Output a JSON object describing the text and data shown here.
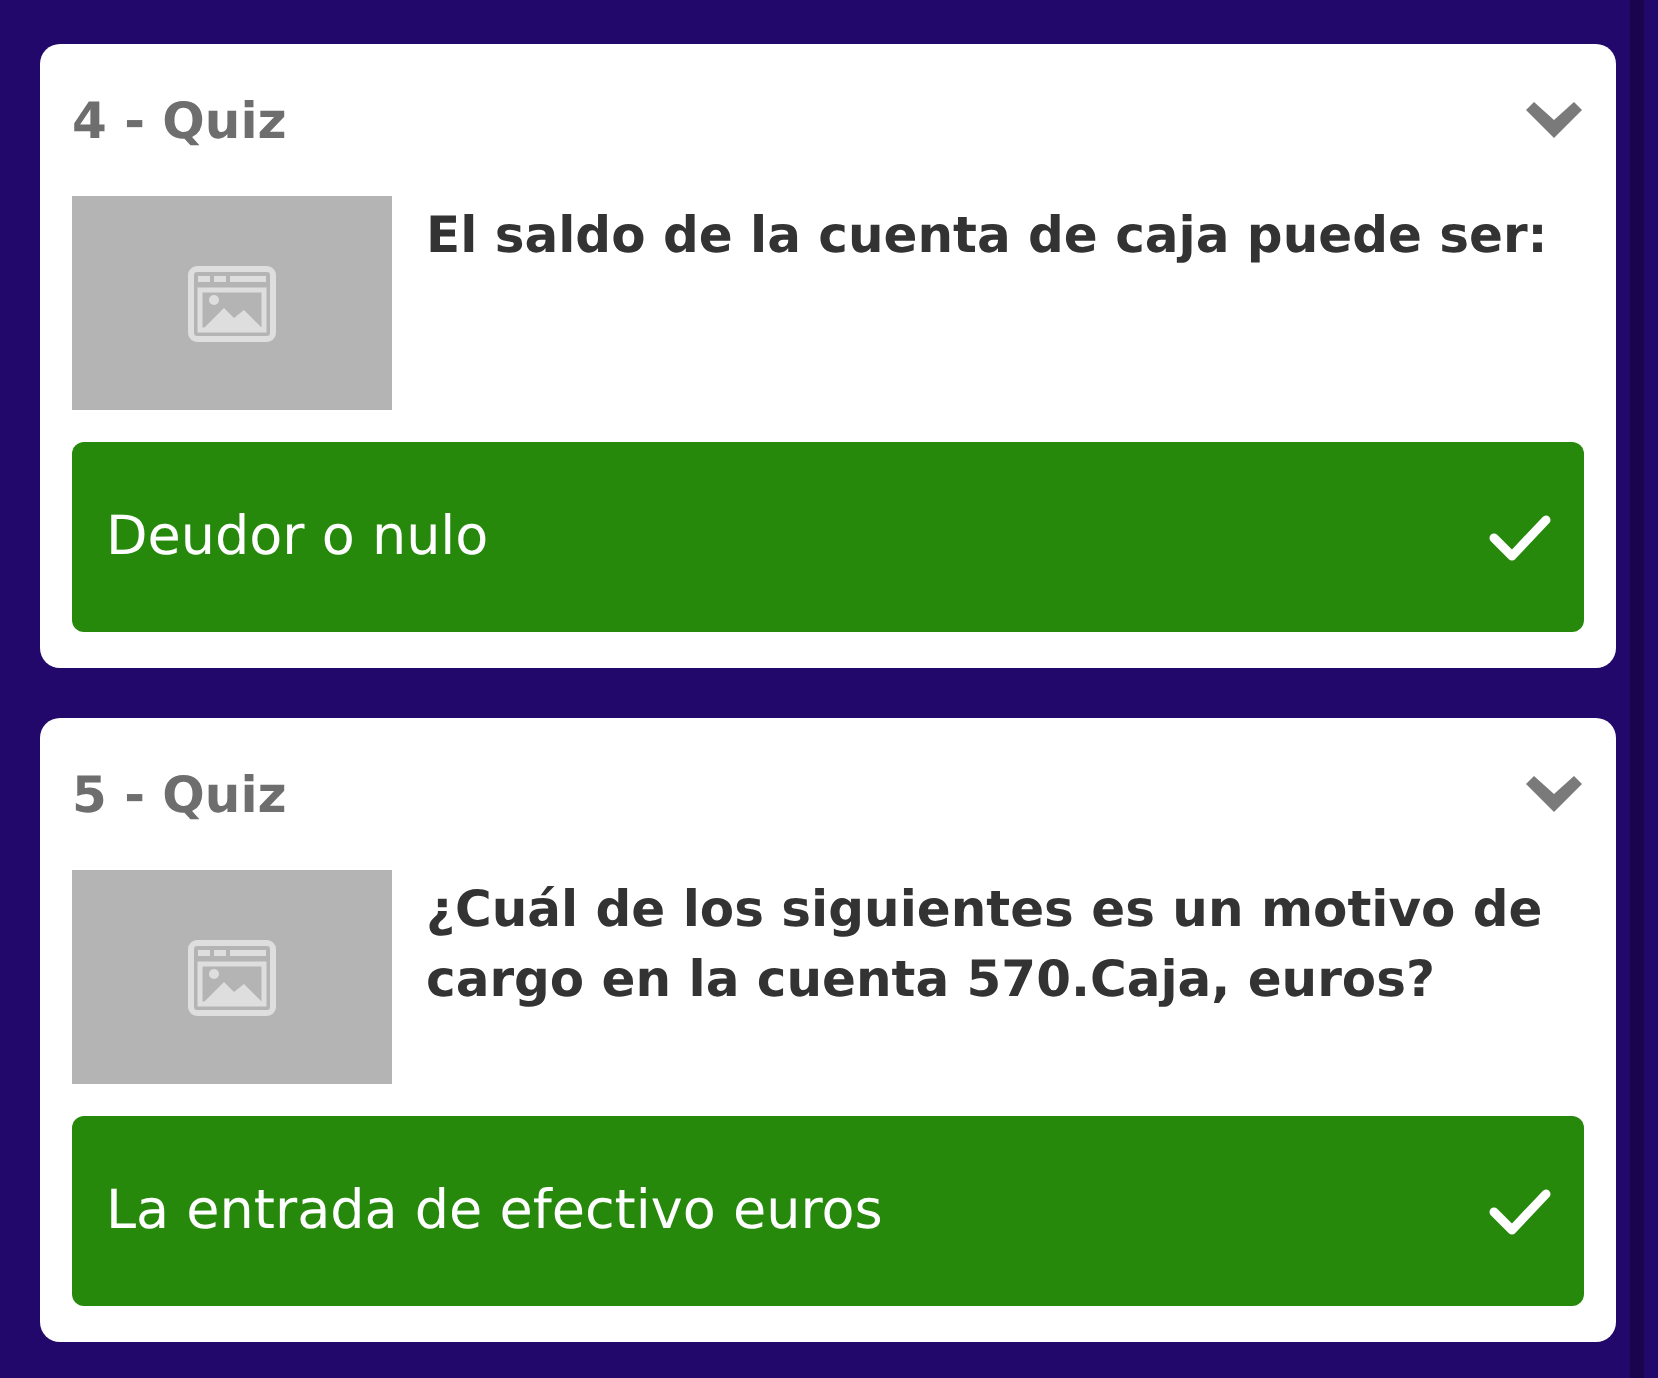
{
  "questions": [
    {
      "title": "4 - Quiz",
      "question": "El saldo de la cuenta de caja puede ser:",
      "answers": [
        {
          "text": "Deudor o nulo",
          "correct": true
        }
      ]
    },
    {
      "title": "5 - Quiz",
      "question": "¿Cuál de los siguientes es un motivo de cargo en la cuenta 570.Caja, euros?",
      "answers": [
        {
          "text": "La entrada de efectivo euros",
          "correct": true
        }
      ]
    }
  ]
}
